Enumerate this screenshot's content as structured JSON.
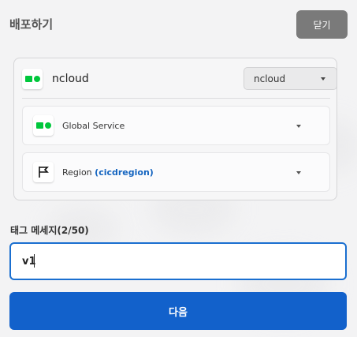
{
  "dialog": {
    "title": "배포하기",
    "close_label": "닫기"
  },
  "provider": {
    "name": "ncloud",
    "selected": "ncloud",
    "icon": "ncloud-logo-icon"
  },
  "service": {
    "label": "Global Service",
    "icon": "ncloud-logo-icon"
  },
  "region": {
    "label": "Region",
    "value": "(cicdregion)",
    "icon": "flag-icon"
  },
  "tag_message": {
    "label": "태그 메세지(2/50)",
    "value": "v1"
  },
  "next_label": "다음",
  "colors": {
    "accent": "#1261cb",
    "close_button": "#7a7a7a",
    "brand_green": "#00c73c"
  }
}
